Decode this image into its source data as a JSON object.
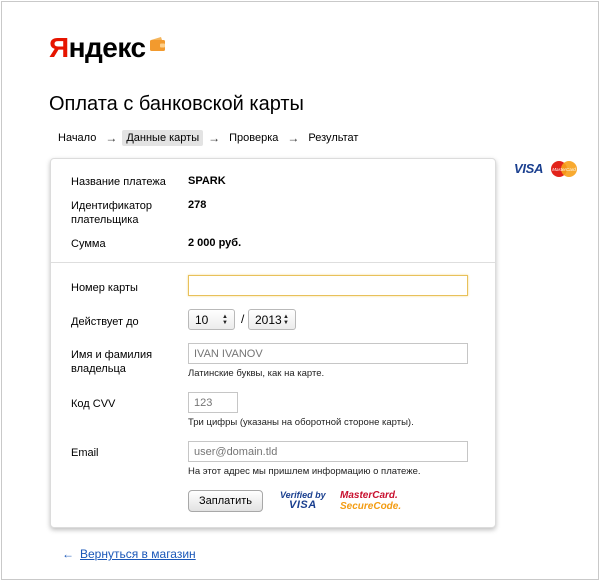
{
  "logo": {
    "letter": "Я",
    "rest": "ндекс"
  },
  "page_title": "Оплата с банковской карты",
  "steps": [
    "Начало",
    "Данные карты",
    "Проверка",
    "Результат"
  ],
  "summary": {
    "payment_name_label": "Название платежа",
    "payment_name_value": "SPARK",
    "payer_id_label_line1": "Идентификатор",
    "payer_id_label_line2": "плательщика",
    "payer_id_value": "278",
    "amount_label": "Сумма",
    "amount_value": "2 000 руб."
  },
  "form": {
    "card_number_label": "Номер карты",
    "card_number_value": "",
    "valid_until_label": "Действует до",
    "month_value": "10",
    "year_value": "2013",
    "slash": "/",
    "name_label_line1": "Имя и фамилия",
    "name_label_line2": "владельца",
    "name_placeholder": "IVAN IVANOV",
    "name_hint": "Латинские буквы, как на карте.",
    "cvv_label": "Код CVV",
    "cvv_placeholder": "123",
    "cvv_hint": "Три цифры (указаны на оборотной стороне карты).",
    "email_label": "Email",
    "email_placeholder": "user@domain.tld",
    "email_hint": "На этот адрес мы пришлем информацию о платеже.",
    "pay_button": "Заплатить",
    "verified_line1": "Verified by",
    "verified_line2": "VISA",
    "securecode_line1": "MasterCard.",
    "securecode_line2": "SecureCode."
  },
  "brands": {
    "visa": "VISA",
    "mastercard": "MasterCard"
  },
  "back_link": "Вернуться в магазин",
  "colors": {
    "yandex_red": "#e61400",
    "wallet_orange": "#f29a2e",
    "link_blue": "#1a57b8"
  }
}
